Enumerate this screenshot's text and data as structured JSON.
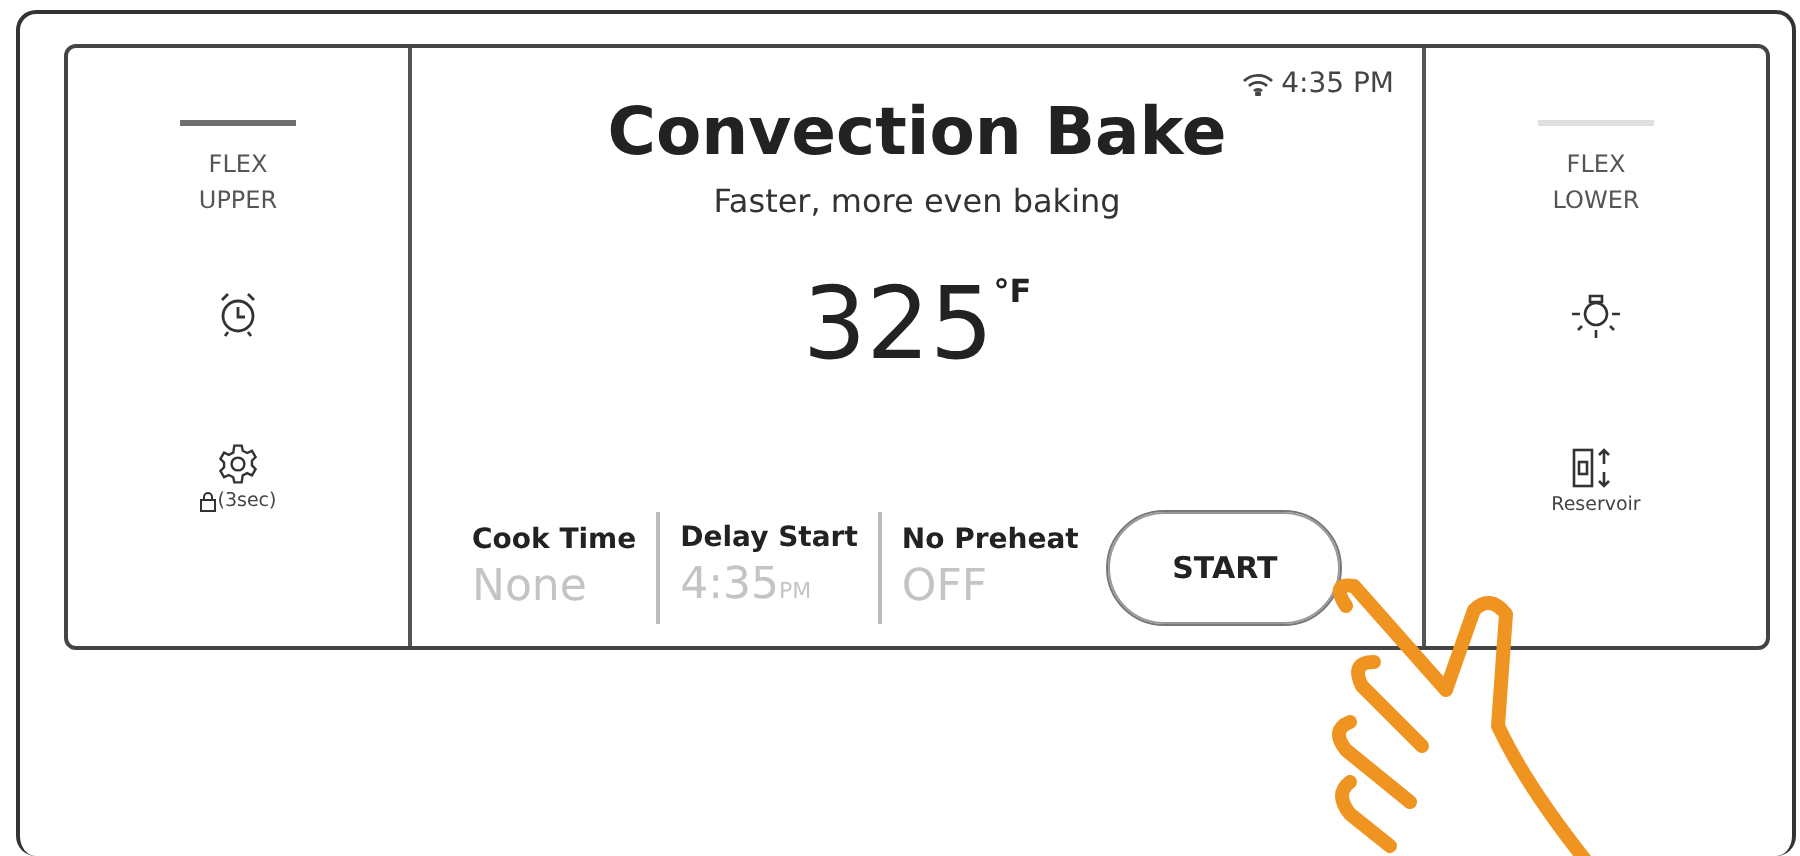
{
  "zones": [
    {
      "kind": "upper",
      "label": "FLEX UPPER",
      "selected": true,
      "bottom_label": "(3sec)"
    },
    {
      "kind": "lower",
      "label": "FLEX LOWER",
      "selected": false,
      "bottom_label": "Reservoir"
    }
  ],
  "status": {
    "time": "4:35 PM"
  },
  "mode": {
    "title": "Convection Bake",
    "subtitle": "Faster, more even baking",
    "temperature": "325",
    "unit": "°F"
  },
  "options": [
    {
      "label": "Cook Time",
      "value": "None"
    },
    {
      "label": "Delay Start",
      "value": "4:35",
      "unit": "PM"
    },
    {
      "label": "No Preheat",
      "value": "OFF"
    }
  ],
  "start_button": {
    "label": "START",
    "pressed": true
  }
}
